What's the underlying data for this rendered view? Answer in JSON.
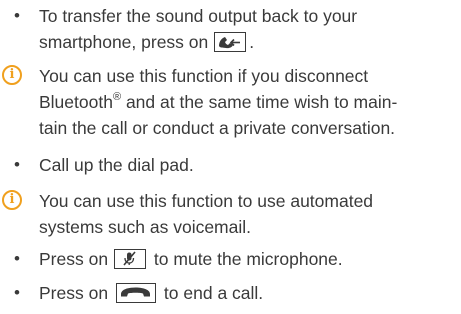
{
  "items": [
    {
      "type": "bullet",
      "lines": [
        "To transfer the sound output back to your",
        "smartphone, press on"
      ],
      "after_icon": "."
    },
    {
      "type": "info",
      "lines": [
        "You can use this function if you disconnect",
        "Bluetooth",
        "and at the same time wish to main-",
        "tain the call or conduct a private conversation."
      ],
      "registered_mark": "®"
    },
    {
      "type": "bullet",
      "lines": [
        "Call up the dial pad."
      ]
    },
    {
      "type": "info",
      "lines": [
        "You can use this function to use automated",
        "systems such as voicemail."
      ]
    },
    {
      "type": "bullet",
      "before": "Press on",
      "after": "to mute the microphone."
    },
    {
      "type": "bullet",
      "before": "Press on",
      "after": "to end a call."
    }
  ],
  "markers": {
    "bullet": "•",
    "info": "i"
  },
  "icons": {
    "transfer_to_phone": "handset-with-arrow-icon",
    "mute_microphone": "muted-microphone-icon",
    "end_call": "hang-up-icon"
  },
  "colors": {
    "text": "#3a3a3a",
    "info_accent": "#f0a01e"
  }
}
